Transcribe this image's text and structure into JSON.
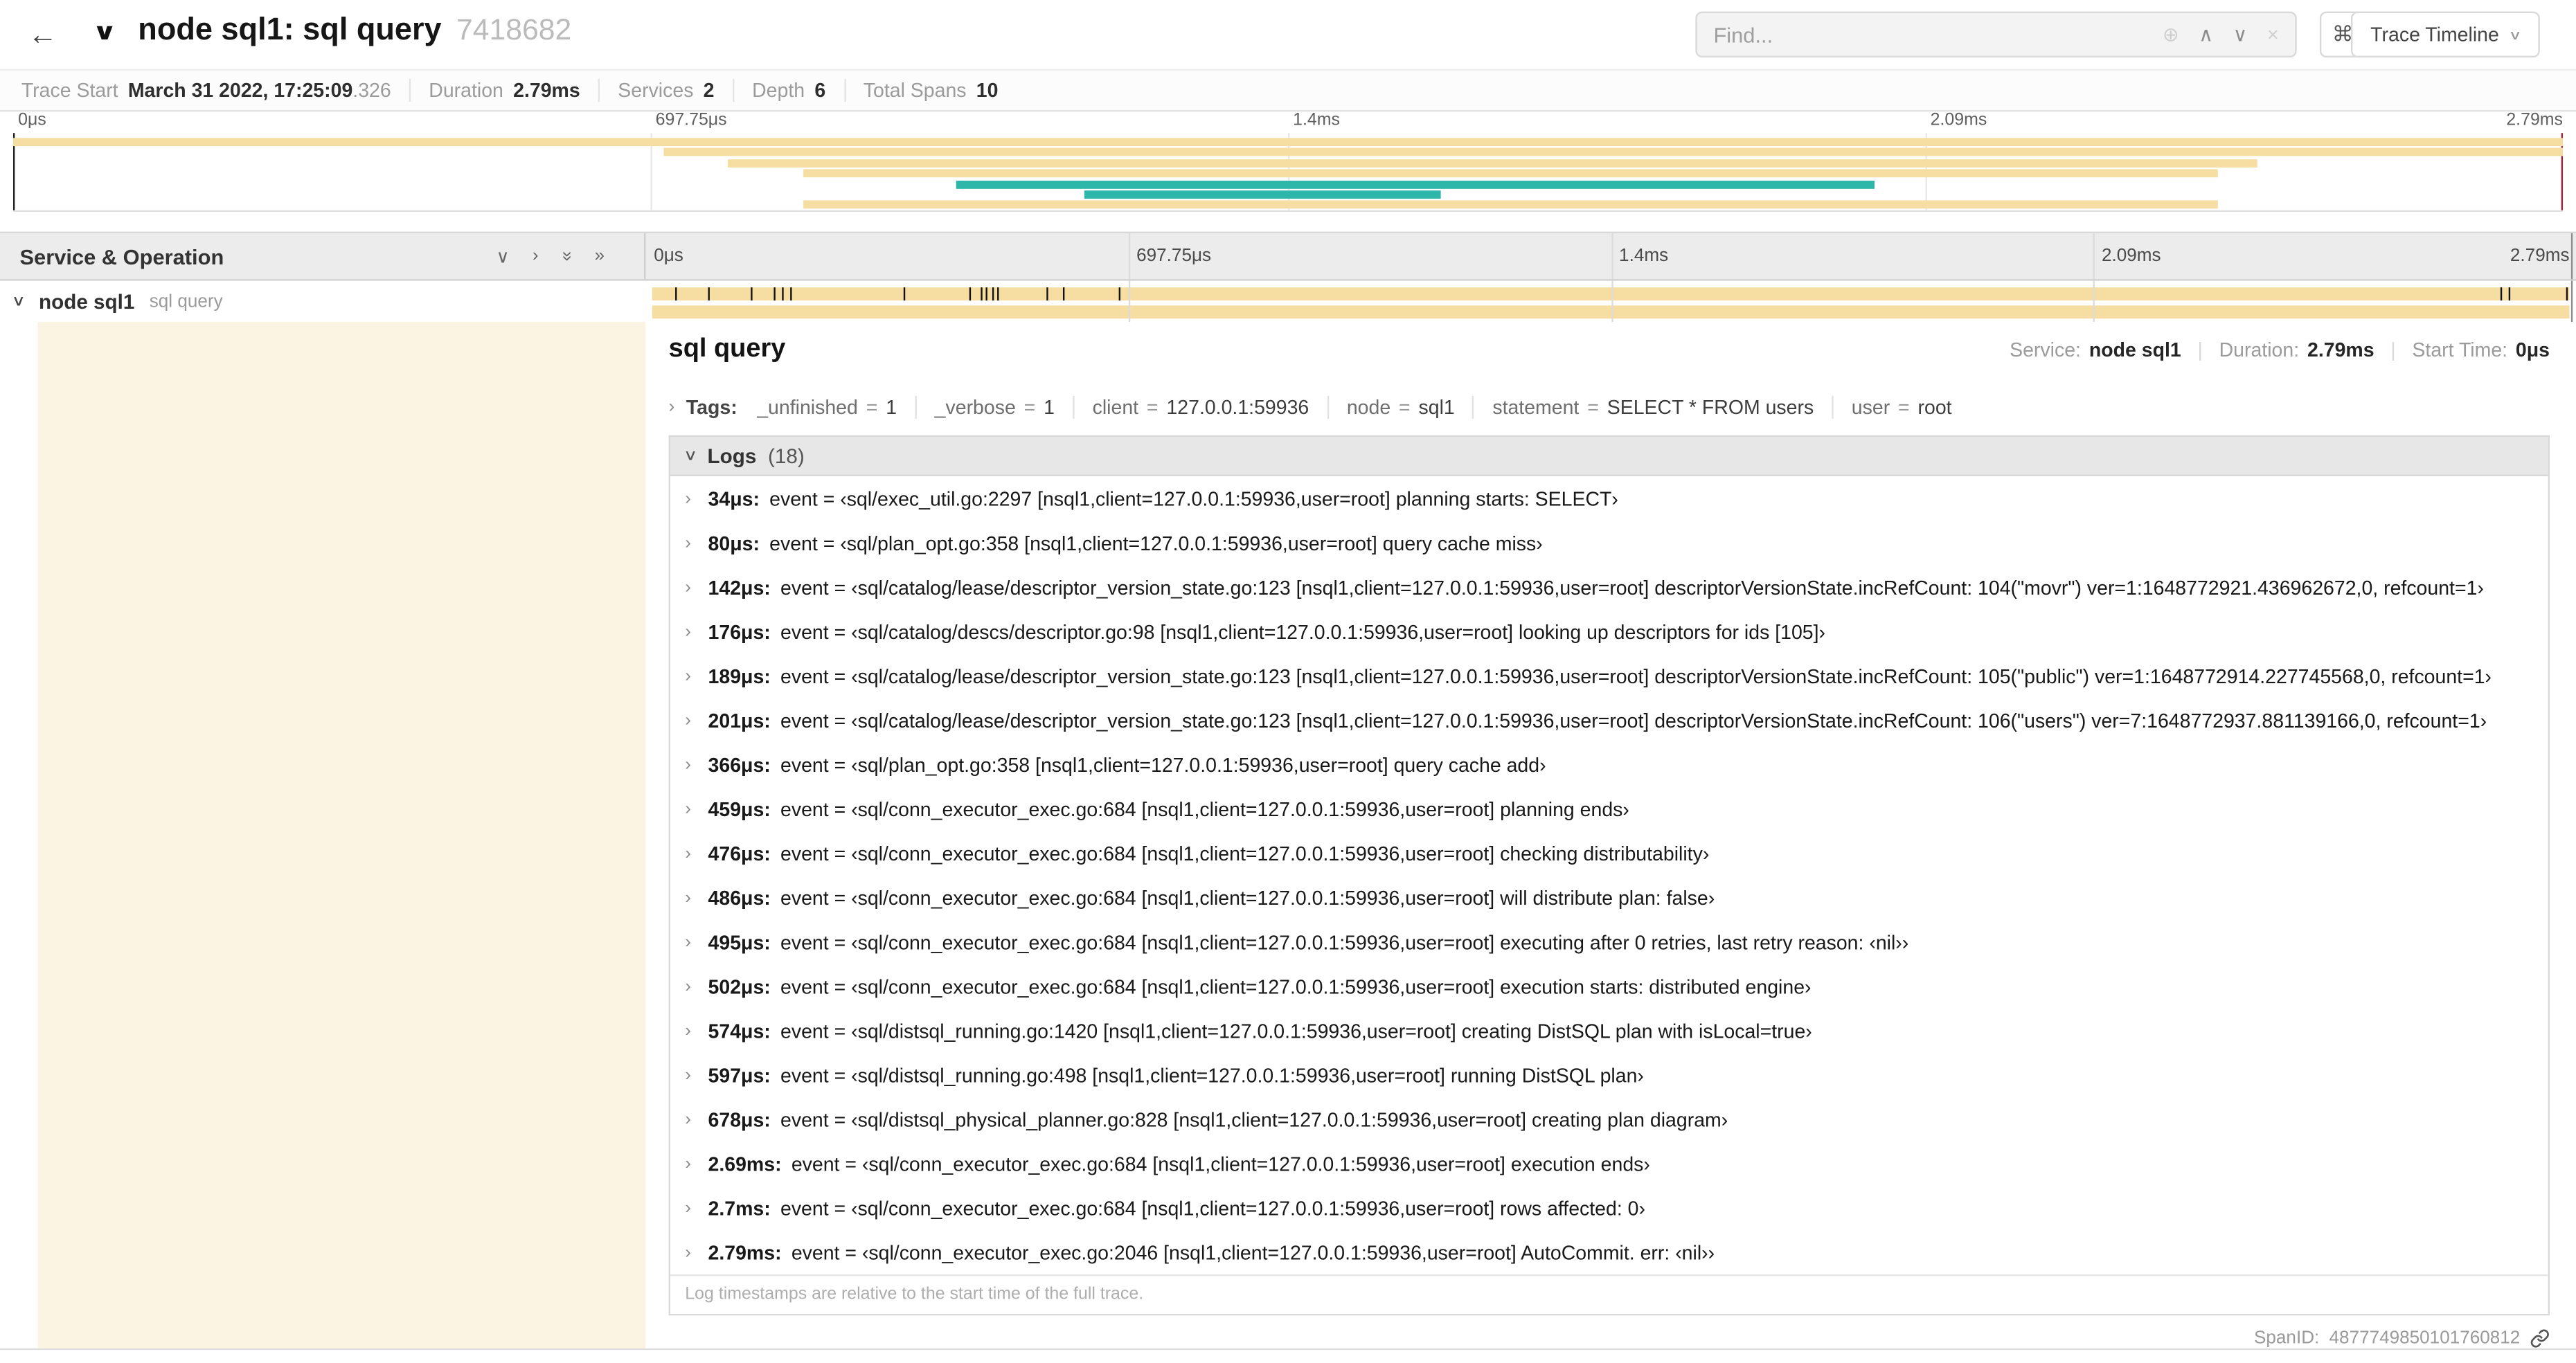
{
  "header": {
    "title": "node sql1: sql query",
    "trace_id": "7418682",
    "find_placeholder": "Find...",
    "view_label": "Trace Timeline"
  },
  "icons": {
    "back": "←",
    "chevron_down": "∨",
    "chevron_right": "›",
    "double_chevron_right": "»",
    "search_zoom": "⊕",
    "prev_result": "∧",
    "next_result": "∨",
    "clear": "×",
    "command": "⌘",
    "dropdown_caret": "∨"
  },
  "summary": {
    "items": [
      {
        "label": "Trace Start",
        "value": "March 31 2022, 17:25:09",
        "suffix": ".326"
      },
      {
        "label": "Duration",
        "value": "2.79ms"
      },
      {
        "label": "Services",
        "value": "2"
      },
      {
        "label": "Depth",
        "value": "6"
      },
      {
        "label": "Total Spans",
        "value": "10"
      }
    ]
  },
  "timeline": {
    "left_header": "Service & Operation",
    "ticks": [
      {
        "label": "0μs",
        "pct": 0
      },
      {
        "label": "697.75μs",
        "pct": 25
      },
      {
        "label": "1.4ms",
        "pct": 50
      },
      {
        "label": "2.09ms",
        "pct": 75
      },
      {
        "label": "2.79ms",
        "pct": 100
      }
    ]
  },
  "minimap": {
    "spans": [
      {
        "row": 0,
        "start": 0,
        "end": 100,
        "color": "tan"
      },
      {
        "row": 1,
        "start": 25.5,
        "end": 100,
        "color": "tan"
      },
      {
        "row": 2,
        "start": 28,
        "end": 88,
        "color": "tan"
      },
      {
        "row": 3,
        "start": 31,
        "end": 86.5,
        "color": "tan"
      },
      {
        "row": 4,
        "start": 37,
        "end": 73,
        "color": "teal"
      },
      {
        "row": 5,
        "start": 42,
        "end": 56,
        "color": "teal"
      },
      {
        "row": 6,
        "start": 31,
        "end": 86.5,
        "color": "tan"
      }
    ]
  },
  "span_row": {
    "service": "node sql1",
    "operation": "sql query",
    "log_tick_pcts": [
      1.2,
      2.9,
      5.1,
      6.3,
      6.8,
      7.2,
      13.1,
      16.5,
      17.1,
      17.4,
      17.7,
      18,
      20.6,
      21.4,
      24.3,
      96.4,
      96.8,
      99.8
    ]
  },
  "detail": {
    "title": "sql query",
    "service_label": "Service:",
    "service_value": "node sql1",
    "duration_label": "Duration:",
    "duration_value": "2.79ms",
    "start_label": "Start Time:",
    "start_value": "0μs",
    "meta_separator": "|",
    "tags_label": "Tags:",
    "tag_equals": "=",
    "tags": [
      {
        "key": "_unfinished",
        "value": "1"
      },
      {
        "key": "_verbose",
        "value": "1"
      },
      {
        "key": "client",
        "value": "127.0.0.1:59936"
      },
      {
        "key": "node",
        "value": "sql1"
      },
      {
        "key": "statement",
        "value": "SELECT * FROM users"
      },
      {
        "key": "user",
        "value": "root"
      }
    ],
    "logs_label": "Logs",
    "logs_count": "(18)",
    "logs": [
      {
        "time": "34μs:",
        "message": "event = ‹sql/exec_util.go:2297 [nsql1,client=127.0.0.1:59936,user=root] planning starts: SELECT›"
      },
      {
        "time": "80μs:",
        "message": "event = ‹sql/plan_opt.go:358 [nsql1,client=127.0.0.1:59936,user=root] query cache miss›"
      },
      {
        "time": "142μs:",
        "message": "event = ‹sql/catalog/lease/descriptor_version_state.go:123 [nsql1,client=127.0.0.1:59936,user=root] descriptorVersionState.incRefCount: 104(\"movr\") ver=1:1648772921.436962672,0, refcount=1›"
      },
      {
        "time": "176μs:",
        "message": "event = ‹sql/catalog/descs/descriptor.go:98 [nsql1,client=127.0.0.1:59936,user=root] looking up descriptors for ids [105]›"
      },
      {
        "time": "189μs:",
        "message": "event = ‹sql/catalog/lease/descriptor_version_state.go:123 [nsql1,client=127.0.0.1:59936,user=root] descriptorVersionState.incRefCount: 105(\"public\") ver=1:1648772914.227745568,0, refcount=1›"
      },
      {
        "time": "201μs:",
        "message": "event = ‹sql/catalog/lease/descriptor_version_state.go:123 [nsql1,client=127.0.0.1:59936,user=root] descriptorVersionState.incRefCount: 106(\"users\") ver=7:1648772937.881139166,0, refcount=1›"
      },
      {
        "time": "366μs:",
        "message": "event = ‹sql/plan_opt.go:358 [nsql1,client=127.0.0.1:59936,user=root] query cache add›"
      },
      {
        "time": "459μs:",
        "message": "event = ‹sql/conn_executor_exec.go:684 [nsql1,client=127.0.0.1:59936,user=root] planning ends›"
      },
      {
        "time": "476μs:",
        "message": "event = ‹sql/conn_executor_exec.go:684 [nsql1,client=127.0.0.1:59936,user=root] checking distributability›"
      },
      {
        "time": "486μs:",
        "message": "event = ‹sql/conn_executor_exec.go:684 [nsql1,client=127.0.0.1:59936,user=root] will distribute plan: false›"
      },
      {
        "time": "495μs:",
        "message": "event = ‹sql/conn_executor_exec.go:684 [nsql1,client=127.0.0.1:59936,user=root] executing after 0 retries, last retry reason: ‹nil››"
      },
      {
        "time": "502μs:",
        "message": "event = ‹sql/conn_executor_exec.go:684 [nsql1,client=127.0.0.1:59936,user=root] execution starts: distributed engine›"
      },
      {
        "time": "574μs:",
        "message": "event = ‹sql/distsql_running.go:1420 [nsql1,client=127.0.0.1:59936,user=root] creating DistSQL plan with isLocal=true›"
      },
      {
        "time": "597μs:",
        "message": "event = ‹sql/distsql_running.go:498 [nsql1,client=127.0.0.1:59936,user=root] running DistSQL plan›"
      },
      {
        "time": "678μs:",
        "message": "event = ‹sql/distsql_physical_planner.go:828 [nsql1,client=127.0.0.1:59936,user=root] creating plan diagram›"
      },
      {
        "time": "2.69ms:",
        "message": "event = ‹sql/conn_executor_exec.go:684 [nsql1,client=127.0.0.1:59936,user=root] execution ends›"
      },
      {
        "time": "2.7ms:",
        "message": "event = ‹sql/conn_executor_exec.go:684 [nsql1,client=127.0.0.1:59936,user=root] rows affected: 0›"
      },
      {
        "time": "2.79ms:",
        "message": "event = ‹sql/conn_executor_exec.go:2046 [nsql1,client=127.0.0.1:59936,user=root] AutoCommit. err: ‹nil››"
      }
    ],
    "logs_footer": "Log timestamps are relative to the start time of the full trace.",
    "spanid_label": "SpanID:",
    "spanid_value": "4877749850101760812"
  },
  "colors": {
    "span_tan": "#f6dda1",
    "span_teal": "#2db7ab",
    "detail_bg": "#fbf4e2"
  }
}
